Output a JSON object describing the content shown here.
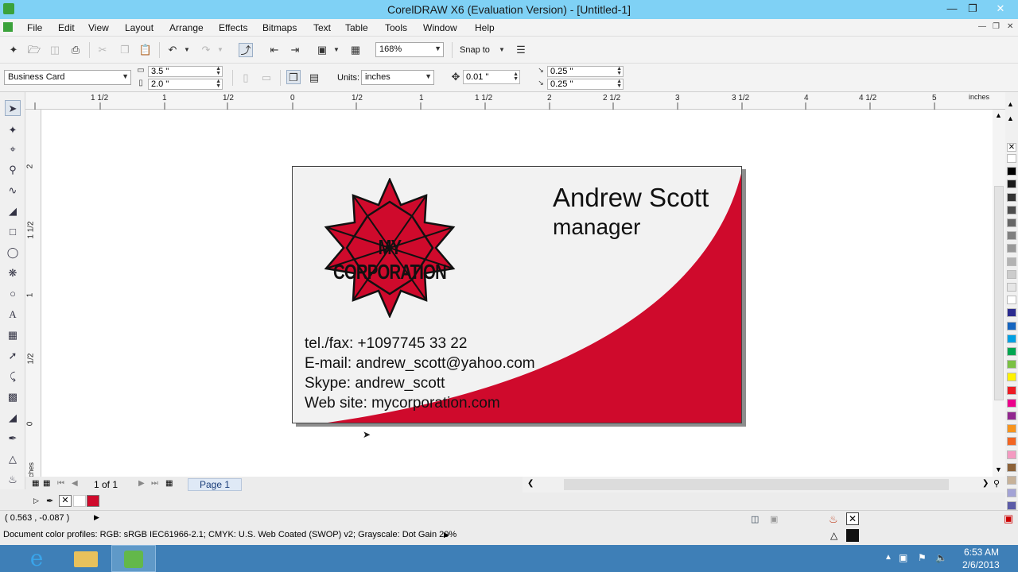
{
  "window": {
    "title": "CorelDRAW X6 (Evaluation Version) - [Untitled-1]"
  },
  "menu": [
    "File",
    "Edit",
    "View",
    "Layout",
    "Arrange",
    "Effects",
    "Bitmaps",
    "Text",
    "Table",
    "Tools",
    "Window",
    "Help"
  ],
  "toolbar": {
    "zoom": "168%",
    "snap_to": "Snap to"
  },
  "property_bar": {
    "page_preset": "Business Card",
    "width": "3.5 \"",
    "height": "2.0 \"",
    "units_label": "Units:",
    "units": "inches",
    "nudge": "0.01 \"",
    "dup_x": "0.25 \"",
    "dup_y": "0.25 \""
  },
  "ruler": {
    "h_ticks": [
      "1 1/2",
      "1",
      "1/2",
      "0",
      "1/2",
      "1",
      "1 1/2",
      "2",
      "2 1/2",
      "3",
      "3 1/2",
      "4",
      "4 1/2",
      "5"
    ],
    "h_units": "inches",
    "v_ticks": [
      "2",
      "1 1/2",
      "1",
      "1/2",
      "0"
    ],
    "v_units": "inches"
  },
  "card": {
    "name": "Andrew Scott",
    "role": "manager",
    "logo_text": "MY CORPORATION",
    "phone": "tel./fax: +1097745 33 22",
    "email": "E-mail: andrew_scott@yahoo.com",
    "skype": "Skype: andrew_scott",
    "website": "Web site: mycorporation.com",
    "accent_color": "#cf0a2c"
  },
  "page_nav": {
    "counter": "1 of 1",
    "page_tab": "Page 1"
  },
  "status": {
    "coordinates": "( 0.563 , -0.087 )",
    "color_profiles": "Document color profiles: RGB: sRGB IEC61966-2.1; CMYK: U.S. Web Coated (SWOP) v2; Grayscale: Dot Gain 20%"
  },
  "taskbar": {
    "time": "6:53 AM",
    "date": "2/6/2013"
  },
  "palette_colors": [
    "#ffffff",
    "#000000",
    "#1a1a1a",
    "#333333",
    "#4d4d4d",
    "#666666",
    "#808080",
    "#999999",
    "#b3b3b3",
    "#cccccc",
    "#e6e6e6",
    "#ffffff",
    "#2b2b8f",
    "#1565c0",
    "#00a0e3",
    "#00a651",
    "#7ac143",
    "#fff200",
    "#ed1c24",
    "#ec008c",
    "#92278f",
    "#f7941d",
    "#f26522",
    "#f49ac1",
    "#8c6239",
    "#c7b299",
    "#a3a3d6",
    "#5c5ca8"
  ]
}
